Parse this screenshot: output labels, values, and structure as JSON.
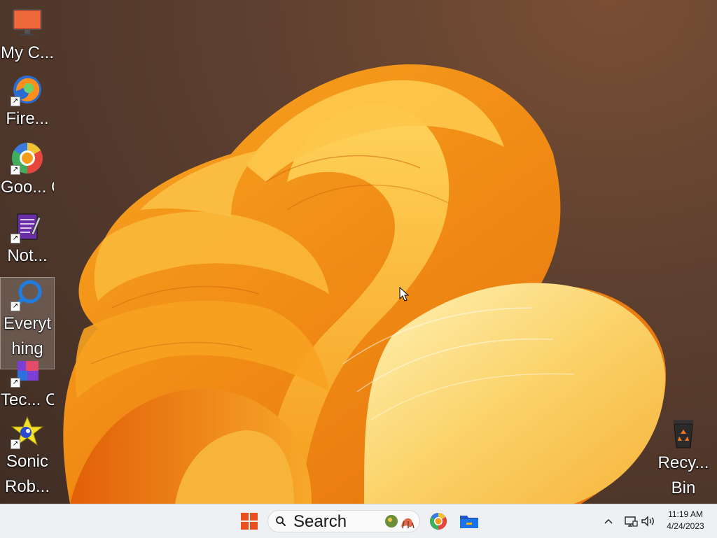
{
  "desktop": {
    "icons": [
      {
        "label": "My C...",
        "icon": "monitor-icon"
      },
      {
        "label": "Fire...",
        "icon": "firefox-icon"
      },
      {
        "label": "Goo... Chr...",
        "icon": "chrome-icon"
      },
      {
        "label": "Not...",
        "icon": "notepad-icon"
      },
      {
        "label": "Everyt hing",
        "icon": "everything-search-icon"
      },
      {
        "label": "Tec... C...",
        "icon": "techsmith-capture-icon"
      },
      {
        "label": "Sonic Rob...",
        "icon": "sonic-robo-icon"
      },
      {
        "label": "Recy... Bin",
        "icon": "recycle-bin-icon"
      }
    ],
    "selected_icon": "Everyt hing"
  },
  "taskbar": {
    "search_label": "Search",
    "pinned_apps": [
      "start-icon",
      "chrome-icon",
      "file-explorer-icon"
    ],
    "tray_icons": [
      "chevron-up-icon",
      "network-icon",
      "volume-icon"
    ],
    "clock": {
      "time": "11:19 AM",
      "date": "4/24/2023"
    }
  },
  "colors": {
    "taskbar_bg": "#eef0f3",
    "wallpaper_orange": "#f39a1c",
    "wallpaper_bg": "#5e4030",
    "start_red": "#e8511d"
  }
}
